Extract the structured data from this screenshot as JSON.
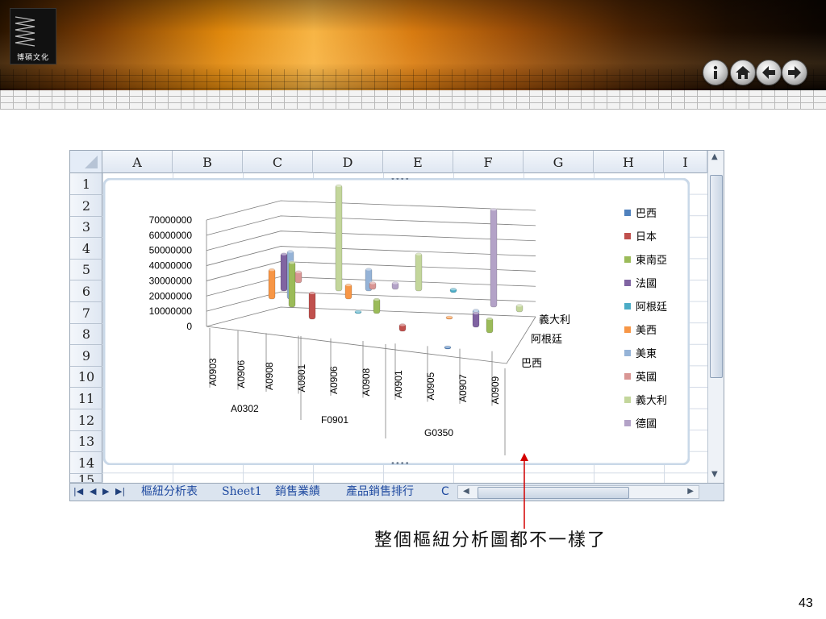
{
  "logo": {
    "text": "博碩文化"
  },
  "nav": [
    "info-icon",
    "home-icon",
    "back-icon",
    "forward-icon"
  ],
  "sheet": {
    "columns": [
      "A",
      "B",
      "C",
      "D",
      "E",
      "F",
      "G",
      "H",
      "I"
    ],
    "rows": [
      "1",
      "2",
      "3",
      "4",
      "5",
      "6",
      "7",
      "8",
      "9",
      "10",
      "11",
      "12",
      "13",
      "14",
      "15"
    ],
    "tabs": [
      "樞紐分析表",
      "Sheet1",
      "銷售業績",
      "產品銷售排行",
      "C"
    ]
  },
  "chart_data": {
    "type": "bar3d",
    "yticks": [
      "70000000",
      "60000000",
      "50000000",
      "40000000",
      "30000000",
      "20000000",
      "10000000",
      "0"
    ],
    "ylim": [
      0,
      70000000
    ],
    "groups": [
      {
        "name": "A0302",
        "items": [
          "A0903",
          "A0906",
          "A0908"
        ]
      },
      {
        "name": "F0901",
        "items": [
          "A0901",
          "A0906",
          "A0908"
        ]
      },
      {
        "name": "G0350",
        "items": [
          "A0901",
          "A0905",
          "A0907",
          "A0909"
        ]
      }
    ],
    "depth_labels": [
      "義大利",
      "阿根廷",
      "巴西"
    ],
    "legend": [
      {
        "name": "巴西",
        "color": "#4f81bd"
      },
      {
        "name": "日本",
        "color": "#c0504d"
      },
      {
        "name": "東南亞",
        "color": "#9bbb59"
      },
      {
        "name": "法國",
        "color": "#8064a2"
      },
      {
        "name": "阿根廷",
        "color": "#4bacc6"
      },
      {
        "name": "美西",
        "color": "#f79646"
      },
      {
        "name": "美東",
        "color": "#95b3d7"
      },
      {
        "name": "英國",
        "color": "#d99694"
      },
      {
        "name": "義大利",
        "color": "#c3d69b"
      },
      {
        "name": "德國",
        "color": "#b3a2c7"
      }
    ],
    "bars": [
      {
        "series": "美西",
        "value": 20000000
      },
      {
        "series": "法國",
        "value": 25000000
      },
      {
        "series": "美東",
        "value": 32000000
      },
      {
        "series": "東南亞",
        "value": 30000000
      },
      {
        "series": "英國",
        "value": 8000000
      },
      {
        "series": "日本",
        "value": 18000000
      },
      {
        "series": "義大利",
        "value": 70000000
      },
      {
        "series": "美西",
        "value": 10000000
      },
      {
        "series": "阿根廷",
        "value": 2000000
      },
      {
        "series": "美東",
        "value": 15000000
      },
      {
        "series": "英國",
        "value": 5000000
      },
      {
        "series": "東南亞",
        "value": 10000000
      },
      {
        "series": "德國",
        "value": 5000000
      },
      {
        "series": "日本",
        "value": 5000000
      },
      {
        "series": "義大利",
        "value": 25000000
      },
      {
        "series": "阿根廷",
        "value": 3000000
      },
      {
        "series": "美西",
        "value": 2000000
      },
      {
        "series": "巴西",
        "value": 1000000
      },
      {
        "series": "美東",
        "value": 4000000
      },
      {
        "series": "法國",
        "value": 10000000
      },
      {
        "series": "德國",
        "value": 65000000
      },
      {
        "series": "東南亞",
        "value": 10000000
      },
      {
        "series": "義大利",
        "value": 5000000
      }
    ]
  },
  "caption": "整個樞紐分析圖都不一樣了",
  "page_number": "43"
}
